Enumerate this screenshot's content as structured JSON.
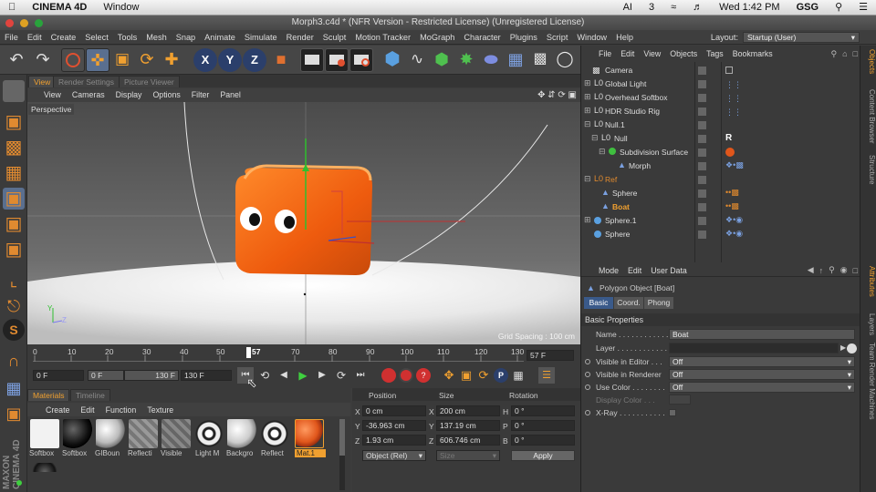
{
  "mac_menubar": {
    "app": "CINEMA 4D",
    "window_menu": "Window",
    "status": {
      "ai": "AI",
      "num": "3",
      "clock": "Wed 1:42 PM",
      "user": "GSG"
    }
  },
  "window": {
    "title": "Morph3.c4d * (NFR Version - Restricted License) (Unregistered License)"
  },
  "main_menu": [
    "File",
    "Edit",
    "Create",
    "Select",
    "Tools",
    "Mesh",
    "Snap",
    "Animate",
    "Simulate",
    "Render",
    "Sculpt",
    "Motion Tracker",
    "MoGraph",
    "Character",
    "Plugins",
    "Script",
    "Window",
    "Help"
  ],
  "layout": {
    "label": "Layout:",
    "value": "Startup (User)"
  },
  "viewport": {
    "tabs": [
      "View",
      "Render Settings",
      "Picture Viewer"
    ],
    "menu": [
      "View",
      "Cameras",
      "Display",
      "Options",
      "Filter",
      "Panel"
    ],
    "camera_label": "Perspective",
    "grid_spacing": "Grid Spacing : 100 cm",
    "axis_y": "Y",
    "axis_z": "Z"
  },
  "timeline": {
    "ticks": [
      "0",
      "10",
      "20",
      "30",
      "40",
      "50",
      "57",
      "70",
      "80",
      "90",
      "100",
      "110",
      "120",
      "130"
    ],
    "current_frame": "57 F",
    "start_field": "0 F",
    "range_start": "0 F",
    "range_end": "130 F",
    "end_field": "130 F"
  },
  "materials": {
    "tabs": [
      "Materials",
      "Timeline"
    ],
    "menu": [
      "Create",
      "Edit",
      "Function",
      "Texture"
    ],
    "items": [
      {
        "name": "Softbox",
        "color": "#f2f2f2"
      },
      {
        "name": "Softbox",
        "color": "#111111"
      },
      {
        "name": "GIBoun",
        "color": "#bbbbbb"
      },
      {
        "name": "Reflecti",
        "color": "#8a8a8a"
      },
      {
        "name": "Visible",
        "color": "#7c7c7c"
      },
      {
        "name": "Light M",
        "color": "#dddddd"
      },
      {
        "name": "Backgro",
        "color": "#c8c8c8"
      },
      {
        "name": "Reflect",
        "color": "#cccccc"
      },
      {
        "name": "Mat.1",
        "color": "#e0561b"
      }
    ]
  },
  "coords": {
    "headers": [
      "Position",
      "Size",
      "Rotation"
    ],
    "rows": [
      {
        "axis": "X",
        "pos": "0 cm",
        "sa": "X",
        "size": "200 cm",
        "ra": "H",
        "rot": "0 °"
      },
      {
        "axis": "Y",
        "pos": "-36.963 cm",
        "sa": "Y",
        "size": "137.19 cm",
        "ra": "P",
        "rot": "0 °"
      },
      {
        "axis": "Z",
        "pos": "1.93 cm",
        "sa": "Z",
        "size": "606.746 cm",
        "ra": "B",
        "rot": "0 °"
      }
    ],
    "mode": "Object (Rel)",
    "size_mode": "Size",
    "apply": "Apply"
  },
  "objects": {
    "menu": [
      "File",
      "Edit",
      "View",
      "Objects",
      "Tags",
      "Bookmarks"
    ],
    "items": [
      {
        "name": "Camera",
        "indent": 0,
        "color": "#dddddd"
      },
      {
        "name": "Global Light",
        "indent": 0,
        "color": "#dddddd"
      },
      {
        "name": "Overhead Softbox",
        "indent": 0,
        "color": "#dddddd"
      },
      {
        "name": "HDR Studio Rig",
        "indent": 0,
        "color": "#dddddd"
      },
      {
        "name": "Null.1",
        "indent": 0,
        "color": "#dddddd"
      },
      {
        "name": "Null",
        "indent": 1,
        "color": "#dddddd"
      },
      {
        "name": "Subdivision Surface",
        "indent": 2,
        "color": "#dddddd"
      },
      {
        "name": "Morph",
        "indent": 3,
        "color": "#dddddd"
      },
      {
        "name": "Ref",
        "indent": 0,
        "color": "#e08a2e"
      },
      {
        "name": "Sphere",
        "indent": 1,
        "color": "#dddddd"
      },
      {
        "name": "Boat",
        "indent": 1,
        "color": "#f0a030"
      },
      {
        "name": "Sphere.1",
        "indent": 0,
        "color": "#dddddd"
      },
      {
        "name": "Sphere",
        "indent": 0,
        "color": "#dddddd"
      }
    ]
  },
  "attributes": {
    "menu": [
      "Mode",
      "Edit",
      "User Data"
    ],
    "object_title": "Polygon Object [Boat]",
    "tabs": [
      "Basic",
      "Coord.",
      "Phong"
    ],
    "section": "Basic Properties",
    "fields": [
      {
        "name": "Name . . . . . . . . . . . . .",
        "value": "Boat"
      },
      {
        "name": "Layer . . . . . . . . . . . .",
        "value": ""
      },
      {
        "name": "Visible in Editor . . .",
        "value": "Off"
      },
      {
        "name": "Visible in Renderer",
        "value": "Off"
      },
      {
        "name": "Use Color . . . . . . . .",
        "value": "Off"
      },
      {
        "name": "Display Color . . .",
        "value": ""
      },
      {
        "name": "X-Ray . . . . . . . . . . .",
        "value": ""
      }
    ]
  },
  "right_tabs": [
    "Objects",
    "Content Browser",
    "Structure",
    "Attributes",
    "Layers",
    "Team Render Machines"
  ],
  "brand": "MAXON CINEMA 4D",
  "colors": {
    "accent": "#f0a030",
    "box": "#ee5b0e",
    "select_blue": "#3a5a8a"
  }
}
